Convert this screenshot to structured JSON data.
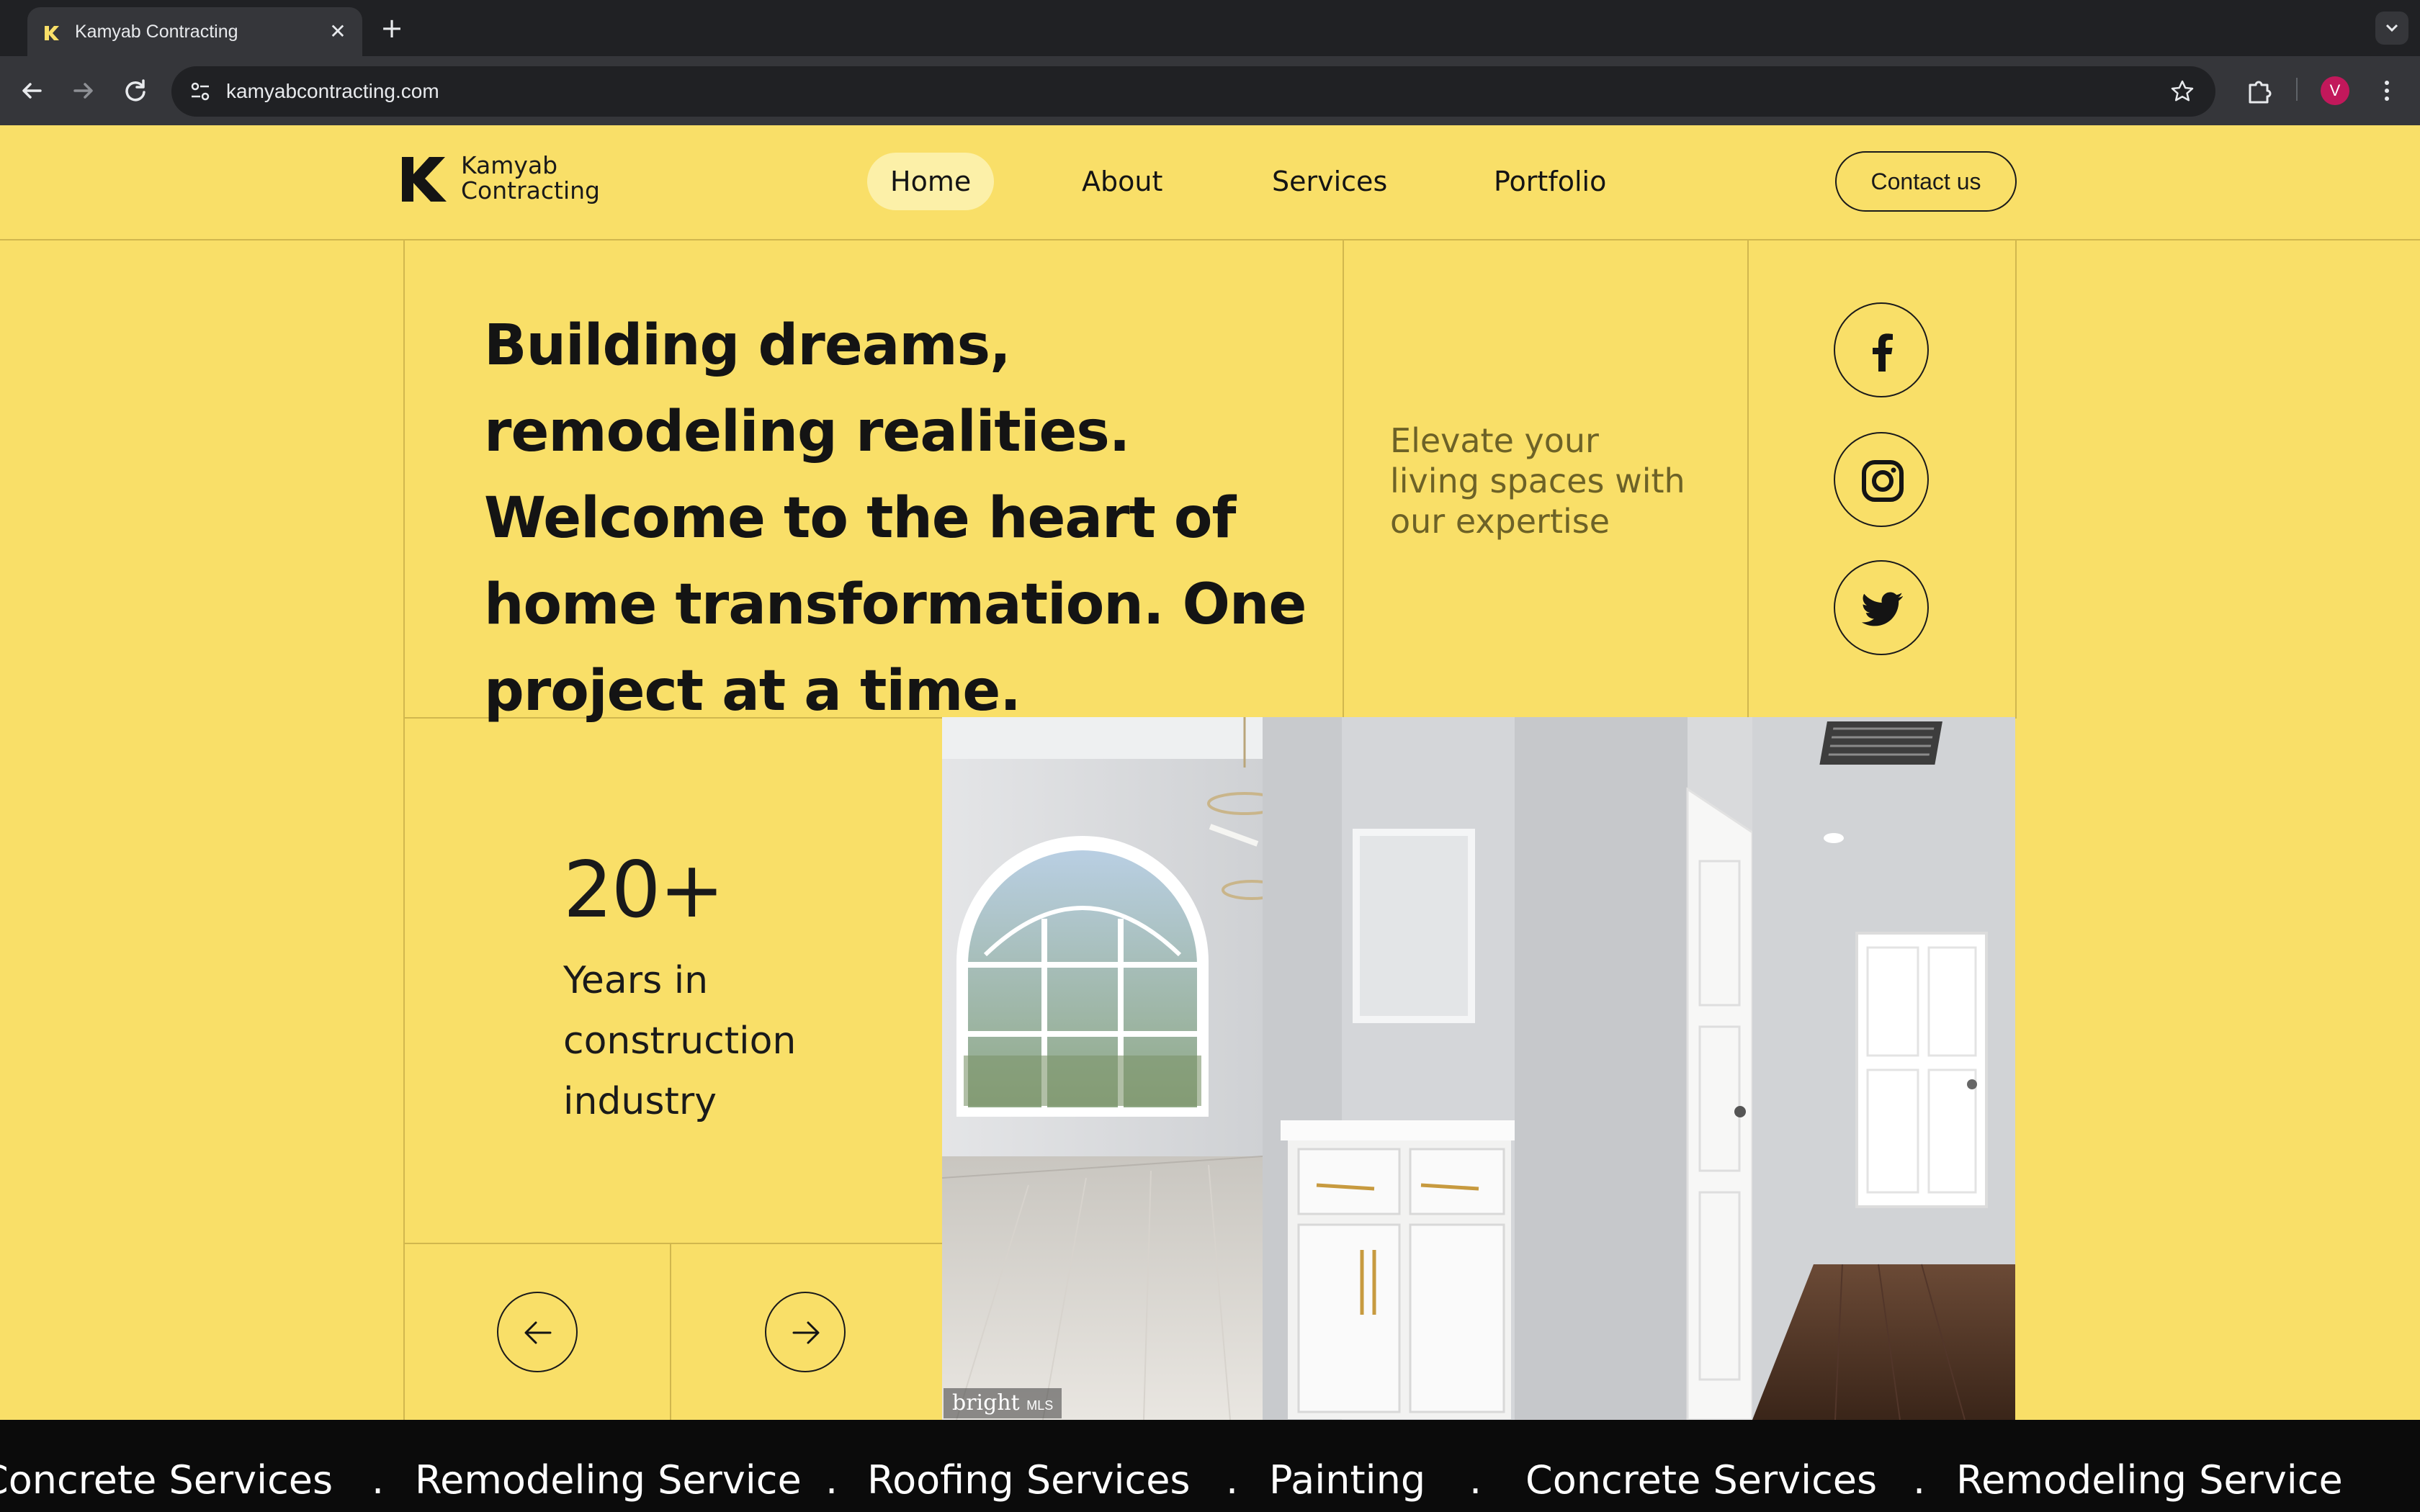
{
  "browser": {
    "tab_title": "Kamyab Contracting",
    "url": "kamyabcontracting.com",
    "avatar_initial": "V"
  },
  "site": {
    "logo_line1": "Kamyab",
    "logo_line2": "Contracting",
    "nav": [
      "Home",
      "About",
      "Services",
      "Portfolio"
    ],
    "active_nav": "Home",
    "contact_label": "Contact us",
    "hero_title": "Building dreams, remodeling realities. Welcome to the heart of home transformation. One project at a time.",
    "tagline": "Elevate your living spaces with our expertise",
    "social_icons": [
      "facebook-icon",
      "instagram-icon",
      "twitter-icon"
    ],
    "stat_number": "20+",
    "stat_label": "Years in construction industry",
    "photo_caption": "bright",
    "photo_caption_small": "MLS",
    "ticker_items": [
      "Concrete Services",
      "Remodeling Service",
      "Roofing Services",
      "Painting",
      "Concrete Services",
      "Remodeling Service"
    ],
    "ticker_separator": "."
  },
  "colors": {
    "brand_yellow": "#f9df68",
    "active_nav_bg": "#fcf0a8",
    "ink": "#141414",
    "tagline": "#6d6227",
    "ticker_bg": "#0b0b0b"
  }
}
